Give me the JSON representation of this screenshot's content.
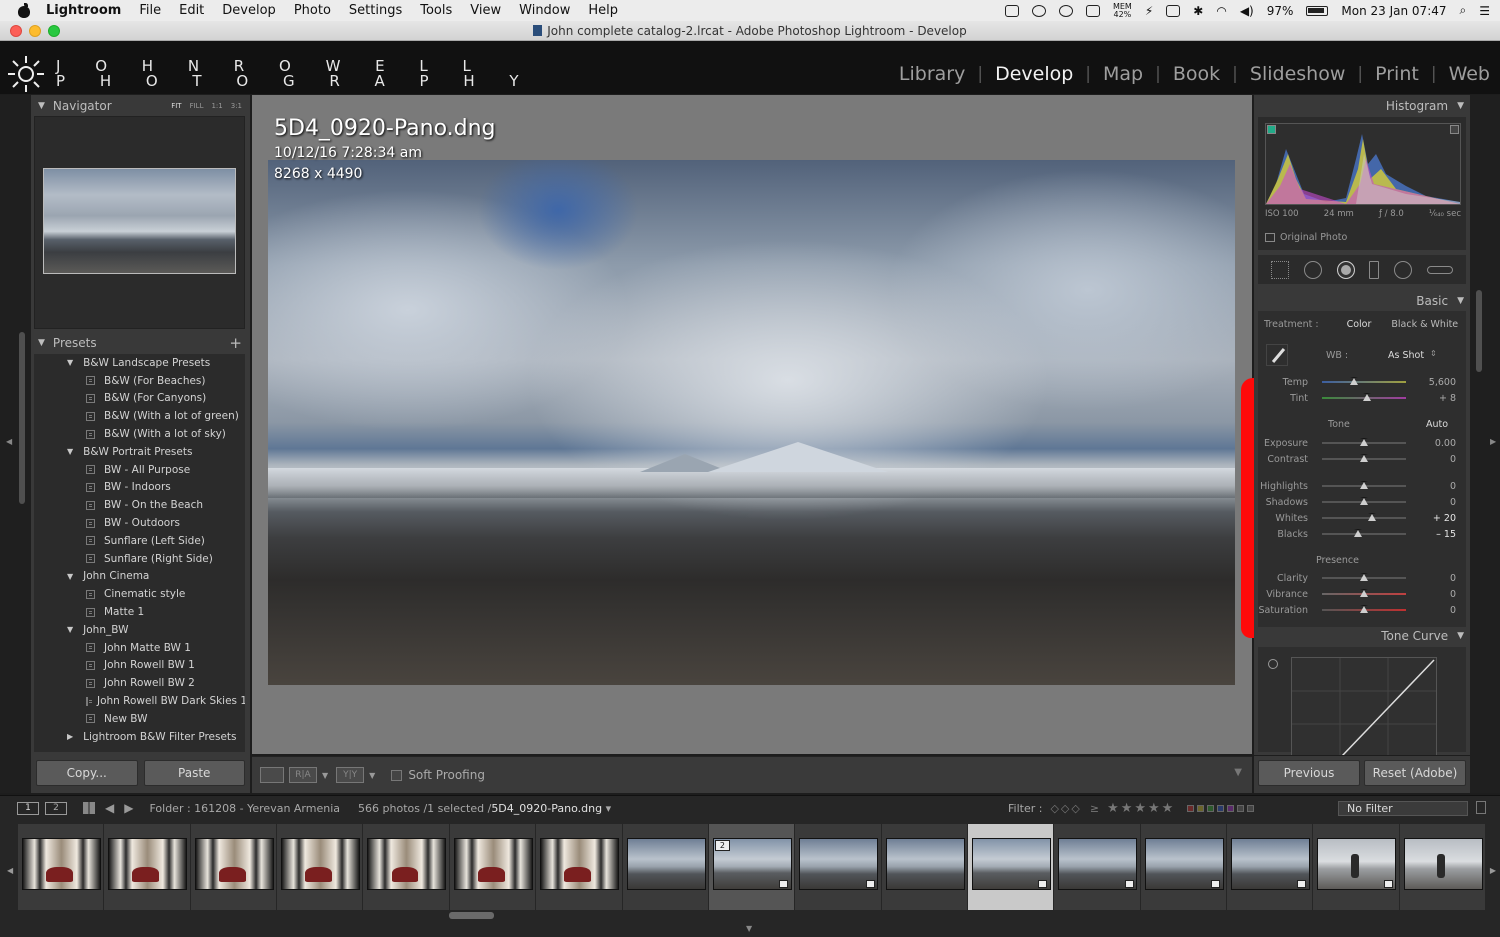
{
  "menubar": {
    "app": "Lightroom",
    "items": [
      "File",
      "Edit",
      "Develop",
      "Photo",
      "Settings",
      "Tools",
      "View",
      "Window",
      "Help"
    ],
    "mem_label": "MEM",
    "mem_value": "42%",
    "battery": "97%",
    "clock": "Mon 23 Jan  07:47"
  },
  "window": {
    "title": "John complete catalog-2.lrcat - Adobe Photoshop Lightroom - Develop"
  },
  "identity": {
    "line1": "J O H N  R O W E L L",
    "line2": "P H O T O G R A P H Y"
  },
  "modules": [
    "Library",
    "Develop",
    "Map",
    "Book",
    "Slideshow",
    "Print",
    "Web"
  ],
  "active_module": "Develop",
  "navigator": {
    "title": "Navigator",
    "zoom": [
      "FIT",
      "FILL",
      "1:1",
      "3:1"
    ]
  },
  "presets": {
    "title": "Presets",
    "add_label": "+",
    "rows": [
      {
        "type": "folder",
        "label": "B&W Landscape Presets",
        "open": true
      },
      {
        "type": "item",
        "label": "B&W (For Beaches)"
      },
      {
        "type": "item",
        "label": "B&W (For Canyons)"
      },
      {
        "type": "item",
        "label": "B&W (With a lot of green)"
      },
      {
        "type": "item",
        "label": "B&W (With a lot of sky)"
      },
      {
        "type": "folder",
        "label": "B&W Portrait Presets",
        "open": true
      },
      {
        "type": "item",
        "label": "BW - All Purpose"
      },
      {
        "type": "item",
        "label": "BW - Indoors"
      },
      {
        "type": "item",
        "label": "BW - On the Beach"
      },
      {
        "type": "item",
        "label": "BW - Outdoors"
      },
      {
        "type": "item",
        "label": "Sunflare (Left Side)"
      },
      {
        "type": "item",
        "label": "Sunflare (Right Side)"
      },
      {
        "type": "folder",
        "label": "John Cinema",
        "open": true
      },
      {
        "type": "item",
        "label": "Cinematic style"
      },
      {
        "type": "item",
        "label": "Matte 1"
      },
      {
        "type": "folder",
        "label": "John_BW",
        "open": true
      },
      {
        "type": "item",
        "label": "John Matte BW 1"
      },
      {
        "type": "item",
        "label": "John Rowell BW 1"
      },
      {
        "type": "item",
        "label": "John Rowell BW 2"
      },
      {
        "type": "item",
        "label": "John Rowell BW Dark Skies 1"
      },
      {
        "type": "item",
        "label": "New BW"
      },
      {
        "type": "folder",
        "label": "Lightroom B&W Filter Presets",
        "open": false
      }
    ]
  },
  "left_buttons": {
    "copy": "Copy...",
    "paste": "Paste"
  },
  "photo": {
    "filename": "5D4_0920-Pano.dng",
    "datetime": "10/12/16 7:28:34 am",
    "dimensions": "8268 x 4490"
  },
  "toolbar": {
    "soft_proofing": "Soft Proofing",
    "view_ra": "R|A",
    "view_yy": "Y|Y"
  },
  "histogram": {
    "title": "Histogram",
    "iso": "ISO 100",
    "focal": "24 mm",
    "aperture": "ƒ / 8.0",
    "shutter": "¹⁄₆₄₀ sec",
    "original_photo": "Original Photo"
  },
  "basic": {
    "title": "Basic",
    "treatment_label": "Treatment :",
    "treatment_color": "Color",
    "treatment_bw": "Black & White",
    "wb_label": "WB :",
    "wb_value": "As Shot",
    "tone_label": "Tone",
    "auto_label": "Auto",
    "presence_label": "Presence",
    "sliders": [
      {
        "label": "Temp",
        "value": "5,600",
        "pos": 0.38,
        "hi": false
      },
      {
        "label": "Tint",
        "value": "+ 8",
        "pos": 0.53,
        "hi": false
      },
      {
        "label": "Exposure",
        "value": "0.00",
        "pos": 0.5,
        "hi": false
      },
      {
        "label": "Contrast",
        "value": "0",
        "pos": 0.5,
        "hi": false
      },
      {
        "label": "Highlights",
        "value": "0",
        "pos": 0.5,
        "hi": false
      },
      {
        "label": "Shadows",
        "value": "0",
        "pos": 0.5,
        "hi": false
      },
      {
        "label": "Whites",
        "value": "+ 20",
        "pos": 0.6,
        "hi": true
      },
      {
        "label": "Blacks",
        "value": "– 15",
        "pos": 0.43,
        "hi": true
      },
      {
        "label": "Clarity",
        "value": "0",
        "pos": 0.5,
        "hi": false
      },
      {
        "label": "Vibrance",
        "value": "0",
        "pos": 0.5,
        "hi": false
      },
      {
        "label": "Saturation",
        "value": "0",
        "pos": 0.5,
        "hi": false
      }
    ]
  },
  "tone_curve": {
    "title": "Tone Curve"
  },
  "right_buttons": {
    "previous": "Previous",
    "reset": "Reset (Adobe)"
  },
  "filmbar": {
    "mon1": "1",
    "mon2": "2",
    "folder": "Folder : 161208 - Yerevan Armenia",
    "count_prefix": "566 photos /1 selected /",
    "count_file": "5D4_0920-Pano.dng",
    "filter_label": "Filter :",
    "rating_op": "≥",
    "stars": "★★★★★",
    "no_filter": "No Filter"
  },
  "filmstrip": {
    "thumbs": [
      {
        "kind": "studio",
        "badge": false
      },
      {
        "kind": "studio",
        "badge": false
      },
      {
        "kind": "studio",
        "badge": false
      },
      {
        "kind": "studio",
        "badge": false
      },
      {
        "kind": "studio",
        "badge": false
      },
      {
        "kind": "studio",
        "badge": false
      },
      {
        "kind": "studio",
        "badge": false
      },
      {
        "kind": "land",
        "badge": false
      },
      {
        "kind": "land2",
        "badge": true,
        "stack": "2",
        "state": "hl"
      },
      {
        "kind": "land",
        "badge": true
      },
      {
        "kind": "land",
        "badge": false
      },
      {
        "kind": "land2",
        "badge": true,
        "state": "sel"
      },
      {
        "kind": "land",
        "badge": true
      },
      {
        "kind": "land",
        "badge": true
      },
      {
        "kind": "land",
        "badge": true
      },
      {
        "kind": "people",
        "badge": true
      },
      {
        "kind": "people",
        "badge": false
      }
    ]
  },
  "colors": {
    "panel_bg": "#393939",
    "accent_red_mark": "#ff0a0a"
  }
}
